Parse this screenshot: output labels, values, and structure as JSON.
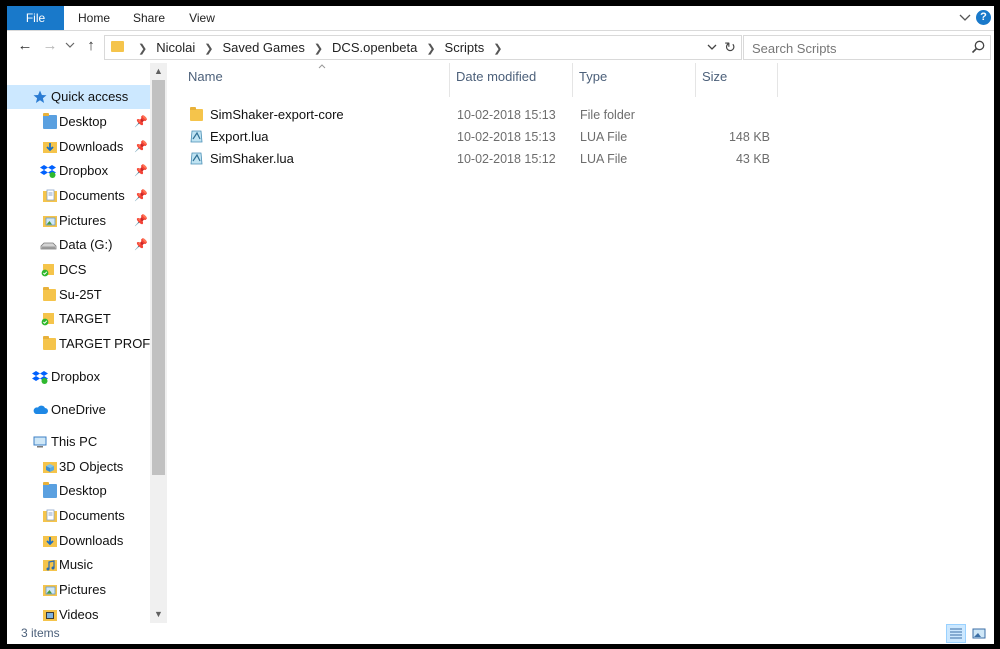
{
  "ribbon": {
    "tabs": [
      "File",
      "Home",
      "Share",
      "View"
    ],
    "help_label": "?"
  },
  "address": {
    "breadcrumbs": [
      "Nicolai",
      "Saved Games",
      "DCS.openbeta",
      "Scripts"
    ]
  },
  "search": {
    "placeholder": "Search Scripts"
  },
  "nav": {
    "quick_access": {
      "label": "Quick access",
      "items": [
        {
          "label": "Desktop",
          "icon": "desktop-folder-icon",
          "pinned": true
        },
        {
          "label": "Downloads",
          "icon": "downloads-folder-icon",
          "pinned": true
        },
        {
          "label": "Dropbox",
          "icon": "dropbox-icon",
          "pinned": true
        },
        {
          "label": "Documents",
          "icon": "documents-folder-icon",
          "pinned": true
        },
        {
          "label": "Pictures",
          "icon": "pictures-folder-icon",
          "pinned": true
        },
        {
          "label": "Data (G:)",
          "icon": "drive-icon",
          "pinned": true
        },
        {
          "label": "DCS",
          "icon": "synced-folder-icon",
          "pinned": false
        },
        {
          "label": "Su-25T",
          "icon": "folder-icon",
          "pinned": false
        },
        {
          "label": "TARGET",
          "icon": "synced-folder-icon",
          "pinned": false
        },
        {
          "label": "TARGET PROFILES",
          "icon": "folder-icon",
          "pinned": false
        }
      ]
    },
    "dropbox": {
      "label": "Dropbox"
    },
    "onedrive": {
      "label": "OneDrive"
    },
    "this_pc": {
      "label": "This PC",
      "items": [
        {
          "label": "3D Objects",
          "icon": "3d-objects-folder-icon"
        },
        {
          "label": "Desktop",
          "icon": "desktop-folder-icon"
        },
        {
          "label": "Documents",
          "icon": "documents-folder-icon"
        },
        {
          "label": "Downloads",
          "icon": "downloads-folder-icon"
        },
        {
          "label": "Music",
          "icon": "music-folder-icon"
        },
        {
          "label": "Pictures",
          "icon": "pictures-folder-icon"
        },
        {
          "label": "Videos",
          "icon": "videos-folder-icon"
        }
      ]
    }
  },
  "columns": {
    "name": "Name",
    "date": "Date modified",
    "type": "Type",
    "size": "Size"
  },
  "files": [
    {
      "name": "SimShaker-export-core",
      "date": "10-02-2018 15:13",
      "type": "File folder",
      "size": "",
      "icon": "folder-icon"
    },
    {
      "name": "Export.lua",
      "date": "10-02-2018 15:13",
      "type": "LUA File",
      "size": "148 KB",
      "icon": "lua-file-icon"
    },
    {
      "name": "SimShaker.lua",
      "date": "10-02-2018 15:12",
      "type": "LUA File",
      "size": "43 KB",
      "icon": "lua-file-icon"
    }
  ],
  "status": {
    "count": "3 items"
  },
  "colors": {
    "accent": "#1979ca",
    "selection": "#cce8ff",
    "folder": "#f5c44b"
  }
}
